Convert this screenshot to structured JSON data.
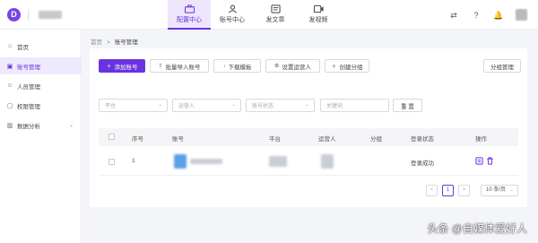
{
  "logo": {
    "text": "D"
  },
  "nav": [
    {
      "label": "配置中心",
      "icon": "briefcase-icon",
      "active": true
    },
    {
      "label": "账号中心",
      "icon": "user-icon"
    },
    {
      "label": "发文章",
      "icon": "article-icon"
    },
    {
      "label": "发视频",
      "icon": "video-icon"
    }
  ],
  "sidebar": {
    "items": [
      {
        "label": "首页",
        "icon": "home-icon"
      },
      {
        "label": "账号管理",
        "icon": "account-icon"
      },
      {
        "label": "人员管理",
        "icon": "person-icon"
      },
      {
        "label": "权限管理",
        "icon": "lock-icon"
      },
      {
        "label": "数据分析",
        "icon": "chart-icon"
      }
    ]
  },
  "breadcrumb": {
    "home": "首页",
    "sep": ">",
    "current": "账号管理"
  },
  "toolbar": {
    "add": "添加账号",
    "import": "批量导入账号",
    "download": "下载模板",
    "set_operator": "设置运营人",
    "create_group": "创建分组",
    "group_manage": "分组管理"
  },
  "filters": {
    "platform": "平台",
    "operator": "运营人",
    "status": "账号状态",
    "keyword": "关键词",
    "reset": "重 置"
  },
  "table": {
    "headers": {
      "index": "序号",
      "account": "账号",
      "platform": "平台",
      "operator": "运营人",
      "group": "分组",
      "login_status": "登录状态",
      "actions": "操作"
    },
    "rows": [
      {
        "index": "1",
        "login_status": "登录成功"
      }
    ]
  },
  "pagination": {
    "prev": "<",
    "page": "1",
    "next": ">",
    "page_size": "10 条/页"
  },
  "watermark": "头条 @自媒体爱好人",
  "colors": {
    "accent": "#6a32e0"
  }
}
